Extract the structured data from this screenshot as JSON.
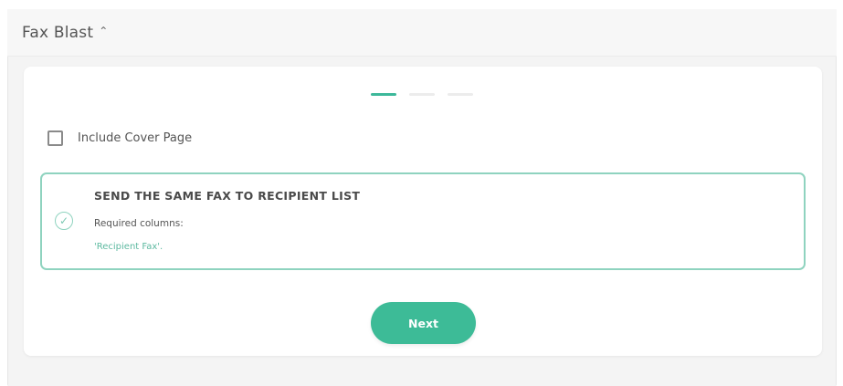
{
  "header": {
    "title": "Fax Blast",
    "chevron_icon": "chevron-up-icon"
  },
  "steps": {
    "total": 3,
    "current": 1
  },
  "cover_page": {
    "label": "Include Cover Page",
    "checked": false
  },
  "option": {
    "title": "SEND THE SAME FAX TO RECIPIENT LIST",
    "required_label": "Required columns:",
    "columns": "'Recipient Fax'.",
    "selected": true
  },
  "actions": {
    "next_label": "Next"
  },
  "colors": {
    "accent": "#3dbb97",
    "accent_light": "#8fd3bf"
  }
}
